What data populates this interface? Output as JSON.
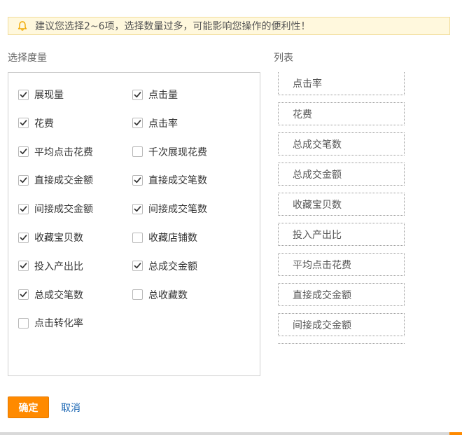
{
  "notice": {
    "icon": "bell-icon",
    "text": "建议您选择2~6项，选择数量过多，可能影响您操作的便利性！"
  },
  "metrics_section": {
    "title": "选择度量",
    "left_column": [
      {
        "label": "展现量",
        "checked": true
      },
      {
        "label": "花费",
        "checked": true
      },
      {
        "label": "平均点击花费",
        "checked": true
      },
      {
        "label": "直接成交金额",
        "checked": true
      },
      {
        "label": "间接成交金额",
        "checked": true
      },
      {
        "label": "收藏宝贝数",
        "checked": true
      },
      {
        "label": "投入产出比",
        "checked": true
      },
      {
        "label": "总成交笔数",
        "checked": true
      },
      {
        "label": "点击转化率",
        "checked": false
      }
    ],
    "right_column": [
      {
        "label": "点击量",
        "checked": true
      },
      {
        "label": "点击率",
        "checked": true
      },
      {
        "label": "千次展现花费",
        "checked": false
      },
      {
        "label": "直接成交笔数",
        "checked": true
      },
      {
        "label": "间接成交笔数",
        "checked": true
      },
      {
        "label": "收藏店铺数",
        "checked": false
      },
      {
        "label": "总成交金额",
        "checked": true
      },
      {
        "label": "总收藏数",
        "checked": false
      }
    ]
  },
  "list_section": {
    "title": "列表",
    "items": [
      "点击率",
      "花费",
      "总成交笔数",
      "总成交金额",
      "收藏宝贝数",
      "投入产出比",
      "平均点击花费",
      "直接成交金额",
      "间接成交金额"
    ]
  },
  "actions": {
    "ok_label": "确定",
    "cancel_label": "取消"
  },
  "colors": {
    "primary": "#ff8a00",
    "link": "#1a66b3",
    "notice_bg": "#fff8dd"
  }
}
